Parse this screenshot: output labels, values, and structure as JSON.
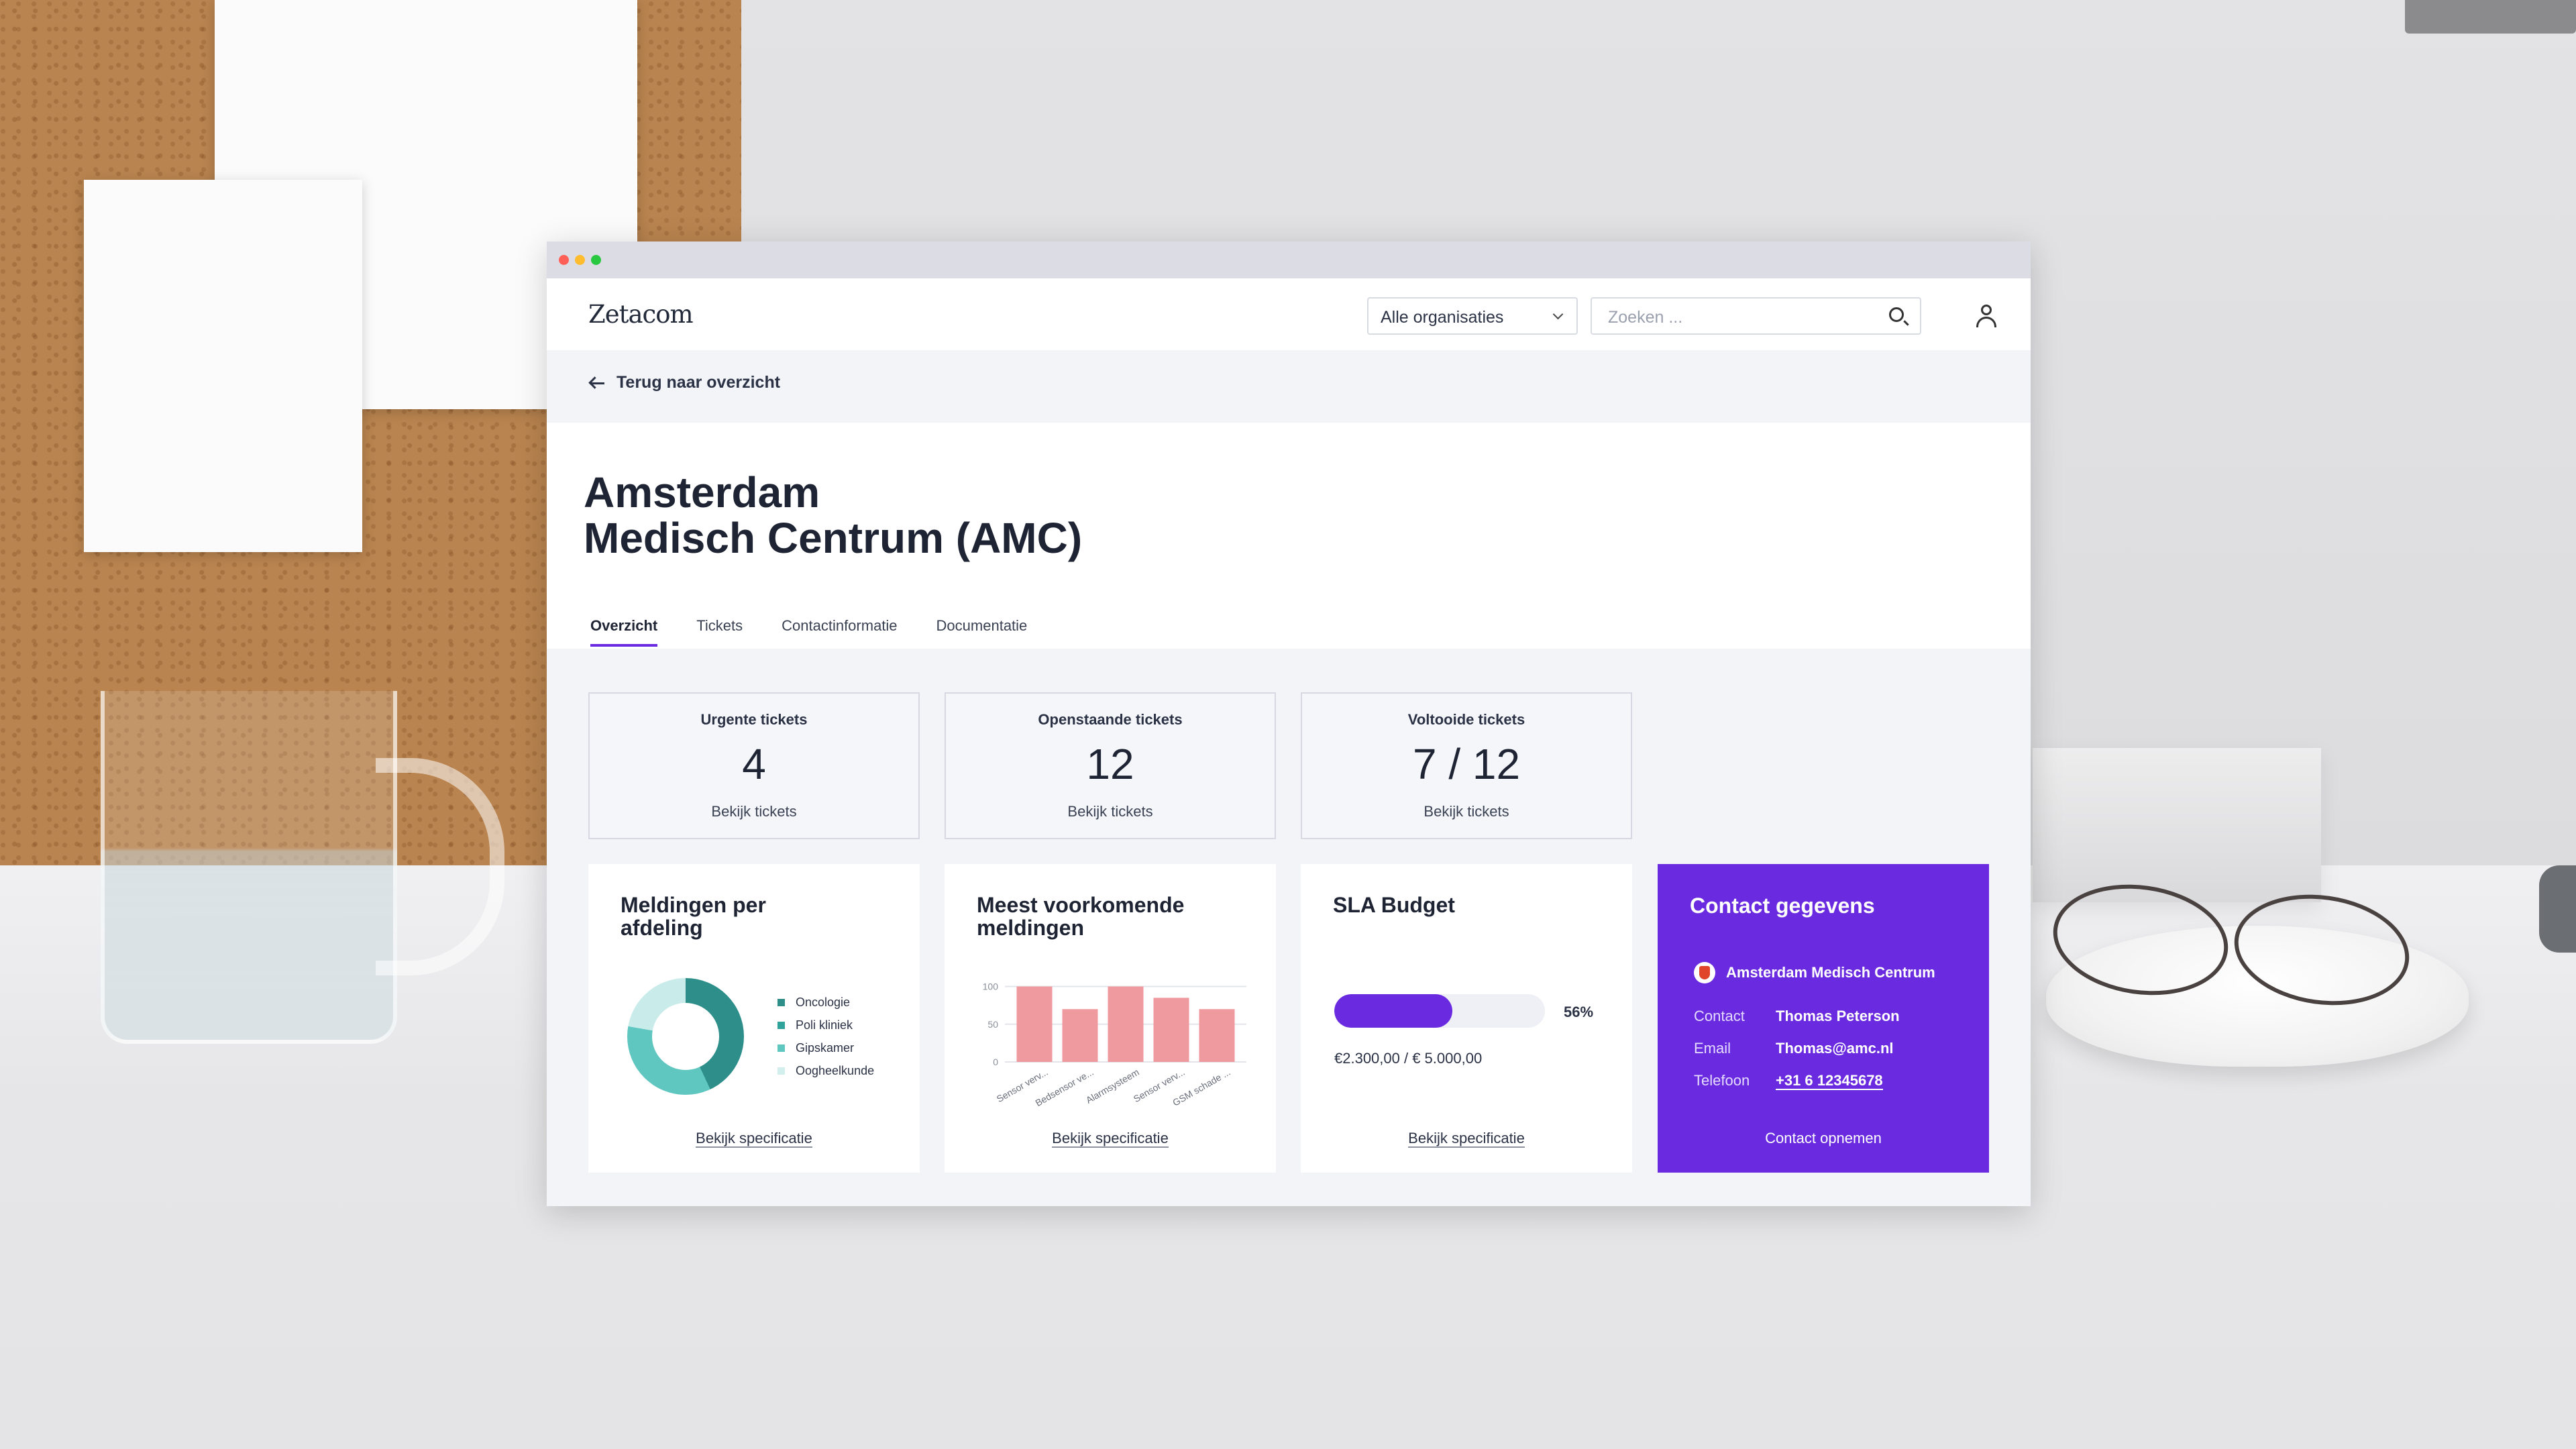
{
  "app": {
    "logo": "Zetacom"
  },
  "header": {
    "org_select": "Alle organisaties",
    "search_placeholder": "Zoeken ..."
  },
  "back_link": "Terug naar overzicht",
  "page": {
    "title_line1": "Amsterdam",
    "title_line2": "Medisch Centrum (AMC)"
  },
  "tabs": [
    {
      "label": "Overzicht",
      "active": true
    },
    {
      "label": "Tickets"
    },
    {
      "label": "Contactinformatie"
    },
    {
      "label": "Documentatie"
    }
  ],
  "stats": [
    {
      "label": "Urgente tickets",
      "value": "4",
      "link": "Bekijk tickets"
    },
    {
      "label": "Openstaande tickets",
      "value": "12",
      "link": "Bekijk tickets"
    },
    {
      "label": "Voltooide tickets",
      "value": "7 / 12",
      "link": "Bekijk tickets"
    }
  ],
  "cards": {
    "departments": {
      "title": "Meldingen per afdeling",
      "legend": [
        "Oncologie",
        "Poli kliniek",
        "Gipskamer",
        "Oogheelkunde"
      ],
      "link": "Bekijk specificatie"
    },
    "frequent": {
      "title": "Meest voorkomende meldingen",
      "link": "Bekijk specificatie"
    },
    "sla": {
      "title": "SLA Budget",
      "percent_label": "56%",
      "amount": "€2.300,00 / € 5.000,00",
      "link": "Bekijk specificatie"
    },
    "contact": {
      "title": "Contact gegevens",
      "org": "Amsterdam Medisch Centrum",
      "rows": [
        {
          "key": "Contact",
          "value": "Thomas Peterson"
        },
        {
          "key": "Email",
          "value": "Thomas@amc.nl"
        },
        {
          "key": "Telefoon",
          "value": "+31 6 12345678"
        }
      ],
      "cta": "Contact opnemen"
    }
  },
  "colors": {
    "accent": "#6a2be0",
    "donut": [
      "#2e8f8a",
      "#2fa39b",
      "#5fc7c0",
      "#d3efed"
    ],
    "bars": "#ef9a9f"
  },
  "chart_data": [
    {
      "type": "pie",
      "title": "Meldingen per afdeling",
      "categories": [
        "Oncologie",
        "Poli kliniek",
        "Gipskamer",
        "Oogheelkunde"
      ],
      "values": [
        25,
        18,
        35,
        22
      ]
    },
    {
      "type": "bar",
      "title": "Meest voorkomende meldingen",
      "categories": [
        "Sensor verv...",
        "Bedsensor ve...",
        "Alarmsysteem",
        "Sensor verv...",
        "GSM schade ..."
      ],
      "values": [
        100,
        70,
        100,
        85,
        70
      ],
      "yticks": [
        0,
        50,
        100
      ],
      "ylim": [
        0,
        120
      ],
      "grid": true
    },
    {
      "type": "bar",
      "title": "SLA Budget",
      "values": [
        0.56
      ],
      "ylim": [
        0,
        1
      ]
    }
  ]
}
